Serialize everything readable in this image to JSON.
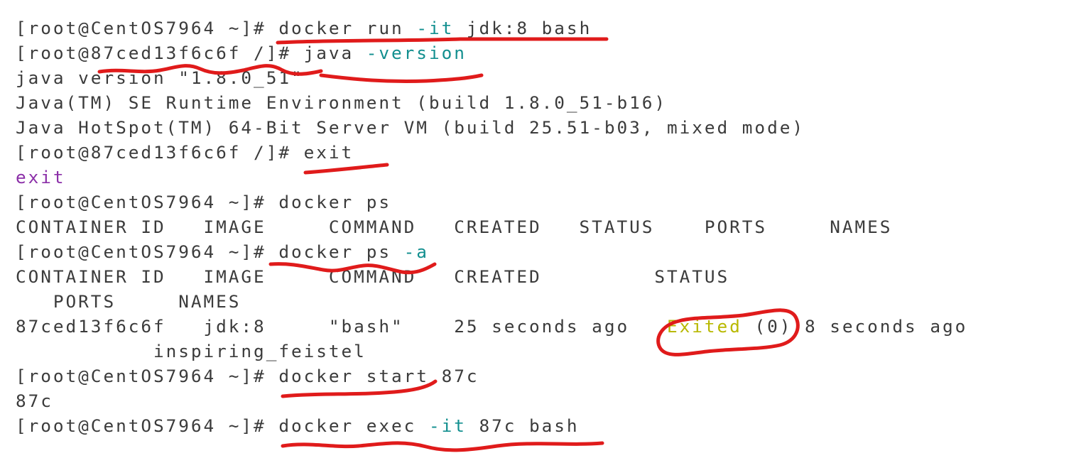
{
  "terminal": {
    "title": "CentOS7964 docker terminal session",
    "background_color": "#ffffff",
    "default_text_color": "#3b3b3b",
    "colors": {
      "teal_flag": "#128f8f",
      "purple_output": "#8b2fa8",
      "yellow_status": "#b8b800",
      "annotation_red": "#e01b1b"
    },
    "lines": [
      {
        "id": "line-01",
        "name": "prompt-docker-run",
        "segments": [
          {
            "text": "[root@CentOS7964 ~]# docker run ",
            "color": "default"
          },
          {
            "text": "-it",
            "color": "teal"
          },
          {
            "text": " jdk:8 bash",
            "color": "default"
          }
        ],
        "plain": "[root@CentOS7964 ~]# docker run -it jdk:8 bash"
      },
      {
        "id": "line-02",
        "name": "prompt-java-version",
        "segments": [
          {
            "text": "[root@87ced13f6c6f /]# java ",
            "color": "default"
          },
          {
            "text": "-version",
            "color": "teal"
          }
        ],
        "plain": "[root@87ced13f6c6f /]# java -version"
      },
      {
        "id": "line-03",
        "name": "output-java-version",
        "segments": [
          {
            "text": "java version \"1.8.0_51\"",
            "color": "default"
          }
        ],
        "plain": "java version \"1.8.0_51\""
      },
      {
        "id": "line-04",
        "name": "output-java-runtime",
        "segments": [
          {
            "text": "Java(TM) SE Runtime Environment (build 1.8.0_51-b16)",
            "color": "default"
          }
        ],
        "plain": "Java(TM) SE Runtime Environment (build 1.8.0_51-b16)"
      },
      {
        "id": "line-05",
        "name": "output-java-hotspot",
        "segments": [
          {
            "text": "Java HotSpot(TM) 64-Bit Server VM (build 25.51-b03, mixed mode)",
            "color": "default"
          }
        ],
        "plain": "Java HotSpot(TM) 64-Bit Server VM (build 25.51-b03, mixed mode)"
      },
      {
        "id": "line-06",
        "name": "prompt-exit",
        "segments": [
          {
            "text": "[root@87ced13f6c6f /]# exit",
            "color": "default"
          }
        ],
        "plain": "[root@87ced13f6c6f /]# exit"
      },
      {
        "id": "line-07",
        "name": "output-exit",
        "segments": [
          {
            "text": "exit",
            "color": "purple"
          }
        ],
        "plain": "exit"
      },
      {
        "id": "line-08",
        "name": "prompt-docker-ps",
        "segments": [
          {
            "text": "[root@CentOS7964 ~]# docker ps",
            "color": "default"
          }
        ],
        "plain": "[root@CentOS7964 ~]# docker ps"
      },
      {
        "id": "line-09",
        "name": "table-header-docker-ps",
        "segments": [
          {
            "text": "CONTAINER ID   IMAGE     COMMAND   CREATED   STATUS    PORTS     NAMES",
            "color": "default"
          }
        ],
        "plain": "CONTAINER ID   IMAGE     COMMAND   CREATED   STATUS    PORTS     NAMES"
      },
      {
        "id": "line-10",
        "name": "prompt-docker-ps-a",
        "segments": [
          {
            "text": "[root@CentOS7964 ~]# docker ps ",
            "color": "default"
          },
          {
            "text": "-a",
            "color": "teal"
          }
        ],
        "plain": "[root@CentOS7964 ~]# docker ps -a"
      },
      {
        "id": "line-11",
        "name": "table-header-docker-ps-a",
        "segments": [
          {
            "text": "CONTAINER ID   IMAGE     COMMAND   CREATED         STATUS",
            "color": "default"
          }
        ],
        "plain": "CONTAINER ID   IMAGE     COMMAND   CREATED         STATUS"
      },
      {
        "id": "line-12",
        "name": "table-header-docker-ps-a-wrap",
        "segments": [
          {
            "text": "   PORTS     NAMES",
            "color": "default"
          }
        ],
        "plain": "   PORTS     NAMES"
      },
      {
        "id": "line-13",
        "name": "table-row-container",
        "segments": [
          {
            "text": "87ced13f6c6f   jdk:8     \"bash\"    25 seconds ago   ",
            "color": "default"
          },
          {
            "text": "Exited",
            "color": "yellow"
          },
          {
            "text": " (0) 8 seconds ago",
            "color": "default"
          }
        ],
        "plain": "87ced13f6c6f   jdk:8     \"bash\"    25 seconds ago   Exited (0) 8 seconds ago"
      },
      {
        "id": "line-14",
        "name": "table-row-container-name",
        "segments": [
          {
            "text": "           inspiring_feistel",
            "color": "default"
          }
        ],
        "plain": "           inspiring_feistel"
      },
      {
        "id": "line-15",
        "name": "prompt-docker-start",
        "segments": [
          {
            "text": "[root@CentOS7964 ~]# docker start 87c",
            "color": "default"
          }
        ],
        "plain": "[root@CentOS7964 ~]# docker start 87c"
      },
      {
        "id": "line-16",
        "name": "output-docker-start",
        "segments": [
          {
            "text": "87c",
            "color": "default"
          }
        ],
        "plain": "87c"
      },
      {
        "id": "line-17",
        "name": "prompt-docker-exec",
        "segments": [
          {
            "text": "[root@CentOS7964 ~]# docker exec ",
            "color": "default"
          },
          {
            "text": "-it",
            "color": "teal"
          },
          {
            "text": " 87c bash",
            "color": "default"
          }
        ],
        "plain": "[root@CentOS7964 ~]# docker exec -it 87c bash"
      }
    ],
    "table_docker_ps": {
      "headers": [
        "CONTAINER ID",
        "IMAGE",
        "COMMAND",
        "CREATED",
        "STATUS",
        "PORTS",
        "NAMES"
      ],
      "rows": []
    },
    "table_docker_ps_a": {
      "headers": [
        "CONTAINER ID",
        "IMAGE",
        "COMMAND",
        "CREATED",
        "STATUS",
        "PORTS",
        "NAMES"
      ],
      "rows": [
        {
          "container_id": "87ced13f6c6f",
          "image": "jdk:8",
          "command": "\"bash\"",
          "created": "25 seconds ago",
          "status": "Exited (0) 8 seconds ago",
          "ports": "",
          "names": "inspiring_feistel"
        }
      ]
    },
    "annotations": [
      {
        "name": "underline-docker-run-it-jdk8-bash",
        "type": "underline",
        "target": "docker run -it jdk:8 bash"
      },
      {
        "name": "squiggle-container-hostname",
        "type": "squiggle",
        "target": "87ced13f6c6f /]#"
      },
      {
        "name": "underline-java-version",
        "type": "underline",
        "target": "java -version"
      },
      {
        "name": "underline-exit-command",
        "type": "underline",
        "target": "exit"
      },
      {
        "name": "squiggle-docker-ps-a",
        "type": "squiggle",
        "target": "docker ps -a"
      },
      {
        "name": "circle-exited-status",
        "type": "circle",
        "target": "Exited (0)"
      },
      {
        "name": "underline-docker-start-87c",
        "type": "underline",
        "target": "docker start 87c"
      },
      {
        "name": "underline-docker-exec-it-87c-bash",
        "type": "underline",
        "target": "docker exec -it 87c bash"
      }
    ]
  }
}
